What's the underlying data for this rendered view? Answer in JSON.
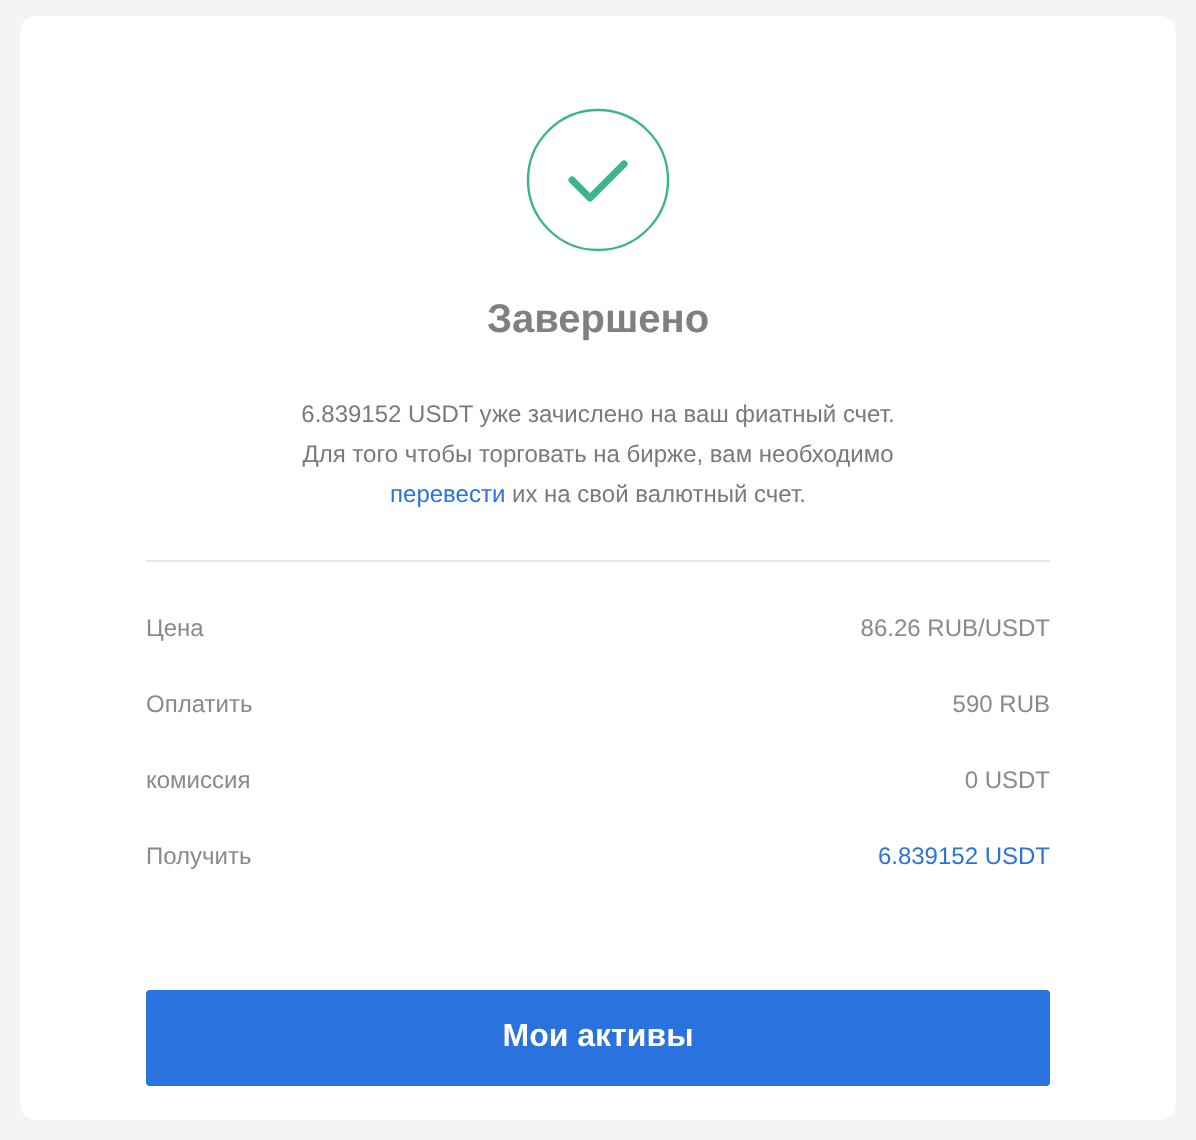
{
  "status": {
    "kind": "success",
    "title": "Завершено"
  },
  "message": {
    "line_1": "6.839152 USDT уже зачислено на ваш фиатный счет.",
    "line_2": "Для того чтобы торговать на бирже, вам необходимо",
    "link": "перевести",
    "line_3": "их на свой валютный счет."
  },
  "details": [
    {
      "label": "Цена",
      "value": "86.26 RUB/USDT",
      "highlight": false
    },
    {
      "label": "Оплатить",
      "value": "590 RUB",
      "highlight": false
    },
    {
      "label": "комиссия",
      "value": "0 USDT",
      "highlight": false
    },
    {
      "label": "Получить",
      "value": "6.839152 USDT",
      "highlight": true
    }
  ],
  "button": "Мои активы"
}
